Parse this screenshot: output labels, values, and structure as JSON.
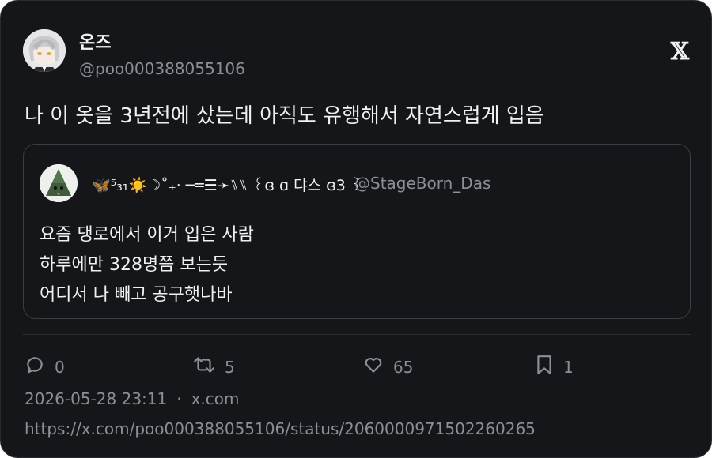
{
  "author": {
    "display_name": "온즈",
    "handle": "@poo000388055106"
  },
  "brand": {
    "logo_glyph": "𝕏"
  },
  "tweet": {
    "text": "나 이 옷을 3년전에 샀는데 아직도 유행해서 자연스럽게 입음"
  },
  "quote": {
    "display_name": "🦋⁵₃₁☀️☽˚₊‧ ─═☰➛⑊⑊ ꒰ɞ ɑ 댜스 ɞ3 ꒱",
    "handle": "@StageBorn_Das",
    "lines": [
      "요즘 댕로에서 이거 입은 사람",
      "하루에만 328명쯤 보는듯",
      "어디서 나 빼고 공구햇나바"
    ]
  },
  "actions": {
    "replies": "0",
    "retweets": "5",
    "likes": "65",
    "bookmarks": "1"
  },
  "meta": {
    "timestamp": "2026-05-28 23:11",
    "separator": "·",
    "source": "x.com",
    "url": "https://x.com/poo000388055106/status/2060000971502260265"
  },
  "colors": {
    "background": "#15161a",
    "text": "#e7e9ea",
    "muted": "#8b9096",
    "border": "#3a3d43"
  }
}
